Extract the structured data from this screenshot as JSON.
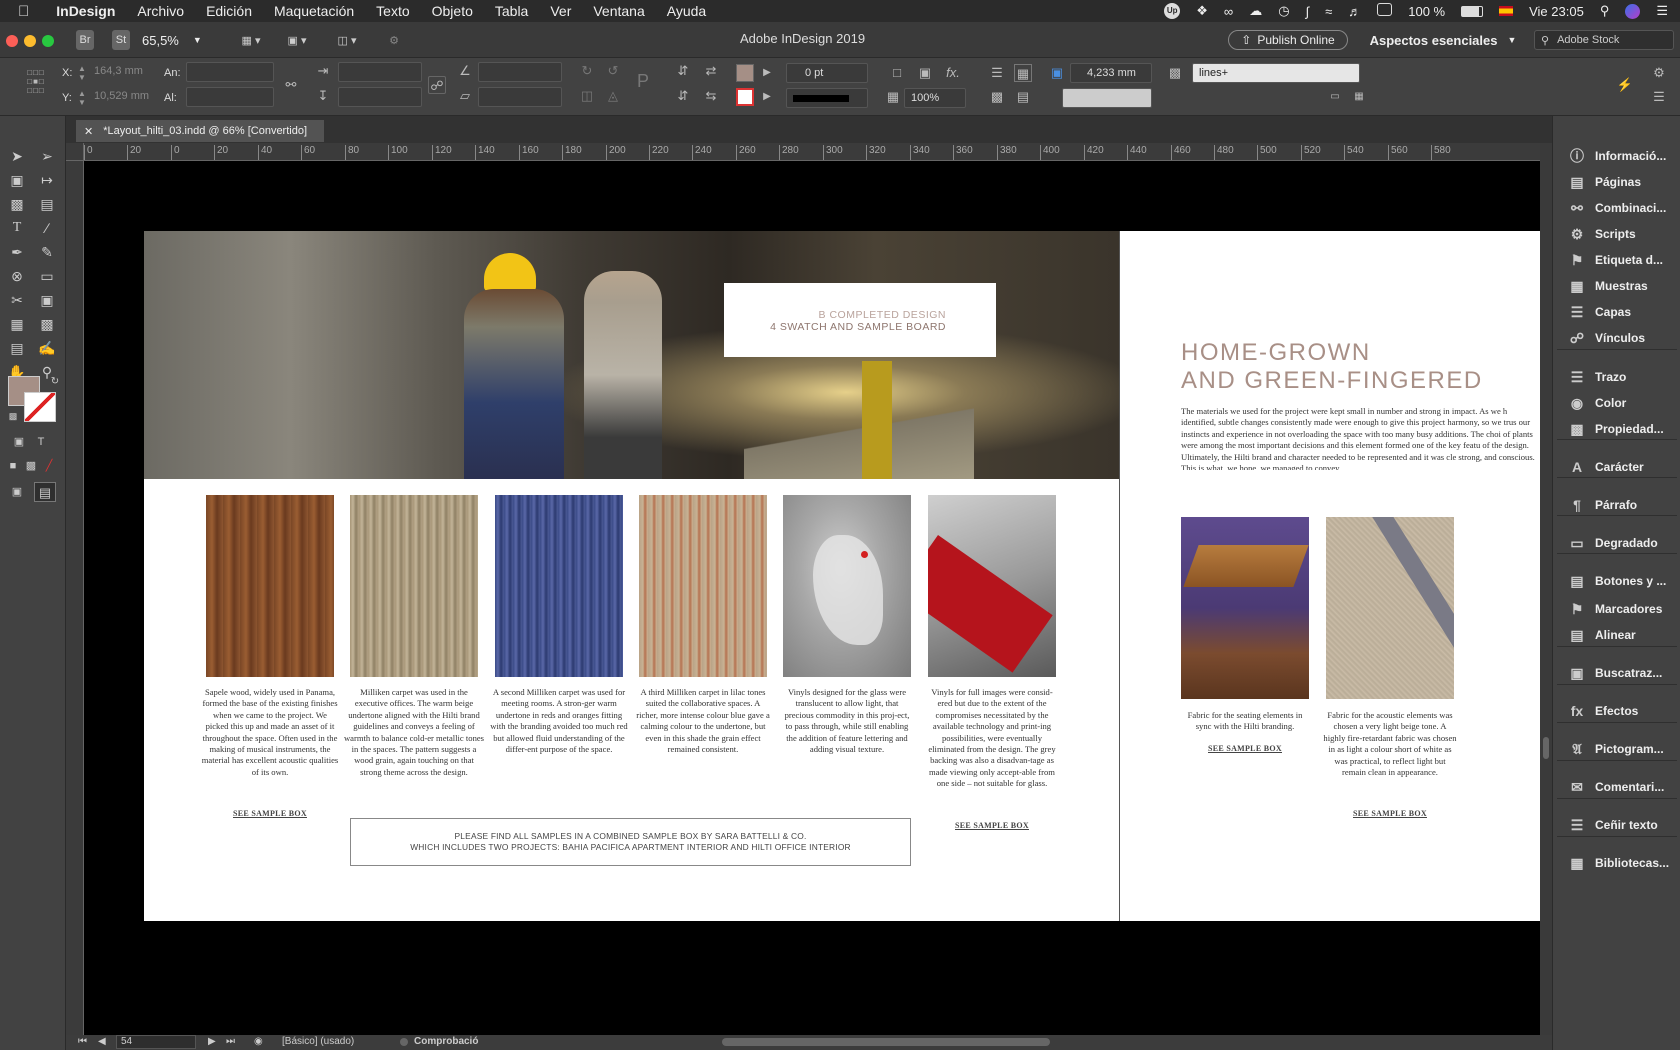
{
  "menubar": {
    "app": "InDesign",
    "items": [
      "Archivo",
      "Edición",
      "Maquetación",
      "Texto",
      "Objeto",
      "Tabla",
      "Ver",
      "Ventana",
      "Ayuda"
    ],
    "battery": "100 %",
    "clock": "Vie 23:05"
  },
  "titlebar": {
    "zoom": "65,5%",
    "app_title": "Adobe InDesign 2019",
    "publish_label": "Publish Online",
    "workspace": "Aspectos esenciales",
    "stock_placeholder": "Adobe Stock",
    "br_label": "Br",
    "st_label": "St"
  },
  "control": {
    "x_label": "X:",
    "y_label": "Y:",
    "x_value": "164,3 mm",
    "y_value": "10,529 mm",
    "w_label": "An:",
    "h_label": "Al:",
    "stroke_weight": "0 pt",
    "scale": "100%",
    "gap_value": "4,233 mm",
    "object_style": "lines+"
  },
  "document": {
    "tab_title": "*Layout_hilti_03.indd @ 66% [Convertido]",
    "ruler_ticks": [
      "0",
      "20",
      "0",
      "20",
      "40",
      "60",
      "80",
      "100",
      "120",
      "140",
      "160",
      "180",
      "200",
      "220",
      "240",
      "260",
      "280",
      "300",
      "320",
      "340",
      "360",
      "380",
      "400",
      "420",
      "440",
      "460",
      "480",
      "500",
      "520",
      "540",
      "560",
      "580"
    ]
  },
  "page_left": {
    "header_box_line1": "B COMPLETED DESIGN",
    "header_box_line2": "4 SWATCH AND SAMPLE BOARD",
    "samples": [
      {
        "caption": "Sapele wood, widely used in Panama, formed the base of the existing finishes when we came to the project. We picked this up and made an asset of it throughout the space. Often used in the making of musical instruments, the material has excellent acoustic qualities of its own.",
        "link": "SEE SAMPLE BOX"
      },
      {
        "caption": "Milliken carpet was used in the executive offices. The warm beige undertone aligned with the Hilti brand guidelines and conveys a feeling of warmth to balance cold-er metallic tones in the spaces. The pattern suggests a wood grain, again touching on that strong theme across the design.",
        "link": ""
      },
      {
        "caption": "A second Milliken carpet was used for meeting rooms. A stron-ger warm undertone in reds and oranges fitting with the branding avoided too much red but allowed fluid understanding of the differ-ent purpose of the space.",
        "link": ""
      },
      {
        "caption": "A third Milliken carpet in lilac tones suited the collaborative spaces. A richer, more intense colour blue gave a calming colour to the undertone, but even in this shade the grain effect remained consistent.",
        "link": ""
      },
      {
        "caption": "Vinyls designed for the glass were translucent to allow light, that precious commodity in this proj-ect, to pass through, while still enabling the addition of feature lettering and adding visual texture.",
        "link": ""
      },
      {
        "caption": "Vinyls for full images were consid-ered but due to the extent of the compromises necessitated by the available technology and print-ing possibilities, were eventually eliminated from the design. The grey backing was also a disadvan-tage as made viewing only accept-able from one side – not suitable for glass.",
        "link": "SEE SAMPLE BOX"
      }
    ],
    "notice_line1": "PLEASE FIND ALL SAMPLES IN A COMBINED SAMPLE BOX BY SARA BATTELLI & CO.",
    "notice_line2": "WHICH INCLUDES TWO PROJECTS: BAHIA PACIFICA APARTMENT INTERIOR AND HILTI OFFICE INTERIOR"
  },
  "page_right": {
    "heading_line1": "HOME-GROWN",
    "heading_line2": "AND GREEN-FINGERED",
    "body": "The materials we used for the project were kept small in number and strong in impact. As we h identified, subtle changes consistently made were enough to give this project harmony, so we trus our instincts and experience in not overloading the space with too many busy additions. The choi of plants were among the most important decisions and this element formed one of the key featu of the design. Ultimately, the Hilti brand and character needed to be represented and it was cle strong, and conscious. This is what, we hope, we managed to convey.",
    "samples": [
      {
        "caption": "Fabric for the seating elements in sync with the Hilti branding.",
        "link": "SEE SAMPLE BOX"
      },
      {
        "caption": "Fabric for the acoustic elements was chosen a very light beige tone. A highly fire-retardant fabric was chosen in as light a colour short of white as was practical, to reflect light but remain clean in appearance.",
        "link": "SEE SAMPLE BOX"
      }
    ]
  },
  "panels": [
    {
      "label": "Informació...",
      "icon": "info-icon"
    },
    {
      "label": "Páginas",
      "icon": "pages-icon"
    },
    {
      "label": "Combinaci...",
      "icon": "merge-icon"
    },
    {
      "label": "Scripts",
      "icon": "scripts-icon"
    },
    {
      "label": "Etiqueta d...",
      "icon": "tag-icon"
    },
    {
      "label": "Muestras",
      "icon": "swatches-icon"
    },
    {
      "label": "Capas",
      "icon": "layers-icon"
    },
    {
      "label": "Vínculos",
      "icon": "links-icon"
    },
    {
      "label": "Trazo",
      "icon": "stroke-icon"
    },
    {
      "label": "Color",
      "icon": "color-icon"
    },
    {
      "label": "Propiedad...",
      "icon": "properties-icon"
    },
    {
      "label": "Carácter",
      "icon": "character-icon"
    },
    {
      "label": "Párrafo",
      "icon": "paragraph-icon"
    },
    {
      "label": "Degradado",
      "icon": "gradient-icon"
    },
    {
      "label": "Botones y ...",
      "icon": "buttons-icon"
    },
    {
      "label": "Marcadores",
      "icon": "bookmark-icon"
    },
    {
      "label": "Alinear",
      "icon": "align-icon"
    },
    {
      "label": "Buscatraz...",
      "icon": "pathfinder-icon"
    },
    {
      "label": "Efectos",
      "icon": "effects-icon"
    },
    {
      "label": "Pictogram...",
      "icon": "glyphs-icon"
    },
    {
      "label": "Comentari...",
      "icon": "comments-icon"
    },
    {
      "label": "Ceñir texto",
      "icon": "text-wrap-icon"
    },
    {
      "label": "Bibliotecas...",
      "icon": "libraries-icon"
    }
  ],
  "status": {
    "page_number": "54",
    "master": "[Básico] (usado)",
    "preflight": "Comprobació"
  }
}
